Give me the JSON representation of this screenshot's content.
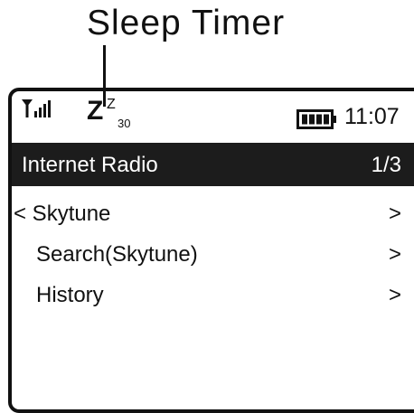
{
  "callout": {
    "label": "Sleep Timer"
  },
  "status_bar": {
    "signal_icon": "signal-strength-icon",
    "sleep_icon": {
      "big_z": "Z",
      "small_z": "Z",
      "minutes": "30"
    },
    "battery_icon": "battery-full-icon",
    "time": "11:07"
  },
  "title_bar": {
    "title": "Internet Radio",
    "page": "1/3"
  },
  "menu": {
    "items": [
      {
        "label": "< Skytune",
        "arrow": ">"
      },
      {
        "label": "Search(Skytune)",
        "arrow": ">"
      },
      {
        "label": "History",
        "arrow": ">"
      }
    ]
  },
  "colors": {
    "title_bar_bg": "#1c1c1c",
    "text": "#111111",
    "background": "#ffffff"
  }
}
